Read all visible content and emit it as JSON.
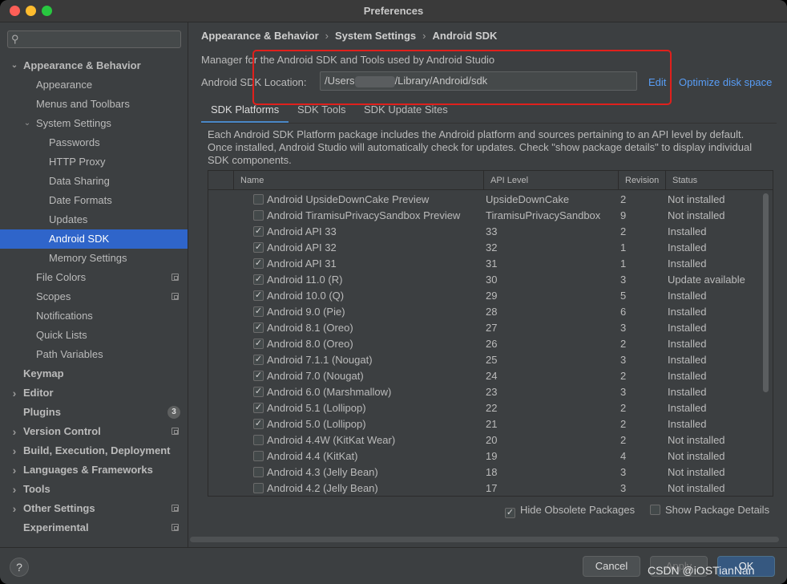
{
  "window": {
    "title": "Preferences"
  },
  "sidebar": {
    "search_placeholder": "",
    "items": [
      {
        "label": "Appearance & Behavior",
        "level": 0,
        "bold": true,
        "arrow": "expanded"
      },
      {
        "label": "Appearance",
        "level": 1
      },
      {
        "label": "Menus and Toolbars",
        "level": 1
      },
      {
        "label": "System Settings",
        "level": 1,
        "arrow": "expanded"
      },
      {
        "label": "Passwords",
        "level": 2
      },
      {
        "label": "HTTP Proxy",
        "level": 2
      },
      {
        "label": "Data Sharing",
        "level": 2
      },
      {
        "label": "Date Formats",
        "level": 2
      },
      {
        "label": "Updates",
        "level": 2
      },
      {
        "label": "Android SDK",
        "level": 2,
        "selected": true
      },
      {
        "label": "Memory Settings",
        "level": 2
      },
      {
        "label": "File Colors",
        "level": 1,
        "icon": "project-icon"
      },
      {
        "label": "Scopes",
        "level": 1,
        "icon": "project-icon"
      },
      {
        "label": "Notifications",
        "level": 1
      },
      {
        "label": "Quick Lists",
        "level": 1
      },
      {
        "label": "Path Variables",
        "level": 1
      },
      {
        "label": "Keymap",
        "level": 0,
        "bold": true
      },
      {
        "label": "Editor",
        "level": 0,
        "bold": true,
        "arrow": "collapsed"
      },
      {
        "label": "Plugins",
        "level": 0,
        "bold": true,
        "badge": "3"
      },
      {
        "label": "Version Control",
        "level": 0,
        "bold": true,
        "arrow": "collapsed",
        "icon": "project-icon"
      },
      {
        "label": "Build, Execution, Deployment",
        "level": 0,
        "bold": true,
        "arrow": "collapsed"
      },
      {
        "label": "Languages & Frameworks",
        "level": 0,
        "bold": true,
        "arrow": "collapsed"
      },
      {
        "label": "Tools",
        "level": 0,
        "bold": true,
        "arrow": "collapsed"
      },
      {
        "label": "Other Settings",
        "level": 0,
        "bold": true,
        "arrow": "collapsed",
        "icon": "project-icon"
      },
      {
        "label": "Experimental",
        "level": 0,
        "bold": true,
        "icon": "project-icon"
      }
    ]
  },
  "breadcrumb": [
    "Appearance & Behavior",
    "System Settings",
    "Android SDK"
  ],
  "main": {
    "description": "Manager for the Android SDK and Tools used by Android Studio",
    "location_label": "Android SDK Location:",
    "location_prefix": "/Users",
    "location_suffix": "/Library/Android/sdk",
    "edit_link": "Edit",
    "optimize_link": "Optimize disk space",
    "tabs": [
      "SDK Platforms",
      "SDK Tools",
      "SDK Update Sites"
    ],
    "package_description": "Each Android SDK Platform package includes the Android platform and sources pertaining to an API level by default. Once installed, Android Studio will automatically check for updates. Check \"show package details\" to display individual SDK components."
  },
  "table": {
    "columns": [
      "Name",
      "API Level",
      "Revision",
      "Status"
    ],
    "rows": [
      {
        "checked": false,
        "name": "Android UpsideDownCake Preview",
        "api": "UpsideDownCake",
        "rev": "2",
        "status": "Not installed"
      },
      {
        "checked": false,
        "name": "Android TiramisuPrivacySandbox Preview",
        "api": "TiramisuPrivacySandbox",
        "rev": "9",
        "status": "Not installed"
      },
      {
        "checked": true,
        "name": "Android API 33",
        "api": "33",
        "rev": "2",
        "status": "Installed"
      },
      {
        "checked": true,
        "name": "Android API 32",
        "api": "32",
        "rev": "1",
        "status": "Installed"
      },
      {
        "checked": true,
        "name": "Android API 31",
        "api": "31",
        "rev": "1",
        "status": "Installed"
      },
      {
        "checked": true,
        "name": "Android 11.0 (R)",
        "api": "30",
        "rev": "3",
        "status": "Update available"
      },
      {
        "checked": true,
        "name": "Android 10.0 (Q)",
        "api": "29",
        "rev": "5",
        "status": "Installed"
      },
      {
        "checked": true,
        "name": "Android 9.0 (Pie)",
        "api": "28",
        "rev": "6",
        "status": "Installed"
      },
      {
        "checked": true,
        "name": "Android 8.1 (Oreo)",
        "api": "27",
        "rev": "3",
        "status": "Installed"
      },
      {
        "checked": true,
        "name": "Android 8.0 (Oreo)",
        "api": "26",
        "rev": "2",
        "status": "Installed"
      },
      {
        "checked": true,
        "name": "Android 7.1.1 (Nougat)",
        "api": "25",
        "rev": "3",
        "status": "Installed"
      },
      {
        "checked": true,
        "name": "Android 7.0 (Nougat)",
        "api": "24",
        "rev": "2",
        "status": "Installed"
      },
      {
        "checked": true,
        "name": "Android 6.0 (Marshmallow)",
        "api": "23",
        "rev": "3",
        "status": "Installed"
      },
      {
        "checked": true,
        "name": "Android 5.1 (Lollipop)",
        "api": "22",
        "rev": "2",
        "status": "Installed"
      },
      {
        "checked": true,
        "name": "Android 5.0 (Lollipop)",
        "api": "21",
        "rev": "2",
        "status": "Installed"
      },
      {
        "checked": false,
        "name": "Android 4.4W (KitKat Wear)",
        "api": "20",
        "rev": "2",
        "status": "Not installed"
      },
      {
        "checked": false,
        "name": "Android 4.4 (KitKat)",
        "api": "19",
        "rev": "4",
        "status": "Not installed"
      },
      {
        "checked": false,
        "name": "Android 4.3 (Jelly Bean)",
        "api": "18",
        "rev": "3",
        "status": "Not installed"
      },
      {
        "checked": false,
        "name": "Android 4.2 (Jelly Bean)",
        "api": "17",
        "rev": "3",
        "status": "Not installed"
      }
    ]
  },
  "options": {
    "hide_obsolete": {
      "label": "Hide Obsolete Packages",
      "checked": true
    },
    "show_details": {
      "label": "Show Package Details",
      "checked": false
    }
  },
  "footer": {
    "help": "?",
    "cancel": "Cancel",
    "apply": "Apply",
    "ok": "OK",
    "watermark": "CSDN @iOSTianNan"
  }
}
